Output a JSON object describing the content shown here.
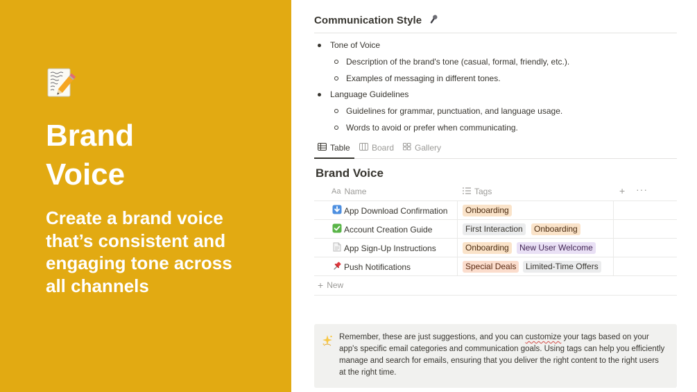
{
  "hero": {
    "icon": "memo-pencil-icon",
    "title_line1": "Brand",
    "title_line2": "Voice",
    "subtitle": "Create a brand voice that’s consistent and engaging tone across all channels",
    "background": "#e2aa12"
  },
  "section": {
    "heading": "Communication Style",
    "heading_icon": "microphone-icon",
    "bullets": [
      {
        "label": "Tone of Voice",
        "children": [
          "Description of the brand's tone (casual, formal, friendly, etc.).",
          "Examples of messaging in different tones."
        ]
      },
      {
        "label": "Language Guidelines",
        "children": [
          "Guidelines for grammar, punctuation, and language usage.",
          "Words to avoid or prefer when communicating."
        ]
      }
    ]
  },
  "tabs": [
    {
      "label": "Table",
      "icon": "table-icon",
      "active": true
    },
    {
      "label": "Board",
      "icon": "board-icon",
      "active": false
    },
    {
      "label": "Gallery",
      "icon": "gallery-icon",
      "active": false
    }
  ],
  "database": {
    "title": "Brand Voice",
    "columns": [
      {
        "label": "Name",
        "icon": "text-property-icon",
        "icon_text": "Aa"
      },
      {
        "label": "Tags",
        "icon": "list-property-icon"
      }
    ],
    "add_column_icon": "plus-icon",
    "more_icon": "ellipsis-icon",
    "rows": [
      {
        "icon": "down-arrow-emoji-icon",
        "name": "App Download Confirmation",
        "tags": [
          "Onboarding"
        ]
      },
      {
        "icon": "check-mark-emoji-icon",
        "name": "Account Creation Guide",
        "tags": [
          "First Interaction",
          "Onboarding"
        ]
      },
      {
        "icon": "page-emoji-icon",
        "name": "App Sign-Up Instructions",
        "tags": [
          "Onboarding",
          "New User Welcome"
        ]
      },
      {
        "icon": "pushpin-emoji-icon",
        "name": "Push Notifications",
        "tags": [
          "Special Deals",
          "Limited-Time Offers"
        ]
      }
    ],
    "new_label": "New"
  },
  "callout": {
    "icon": "sparkle-emoji-icon",
    "text_before": "Remember, these are just suggestions, and you can ",
    "text_misspelled": "customize",
    "text_after": " your tags based on your app's specific email categories and communication goals. Using tags can help you efficiently manage and search for emails, ensuring that you deliver the right content to the right users at the right time."
  },
  "colors": {
    "accent_yellow": "#e2aa12",
    "tag_onboarding": "#fae3c9",
    "tag_first_interaction": "#ebeced",
    "tag_new_user_welcome": "#e9e0f5",
    "tag_special_deals": "#fbddcd",
    "tag_limited_time_offers": "#ebeced",
    "callout_bg": "#f1f1ef"
  }
}
